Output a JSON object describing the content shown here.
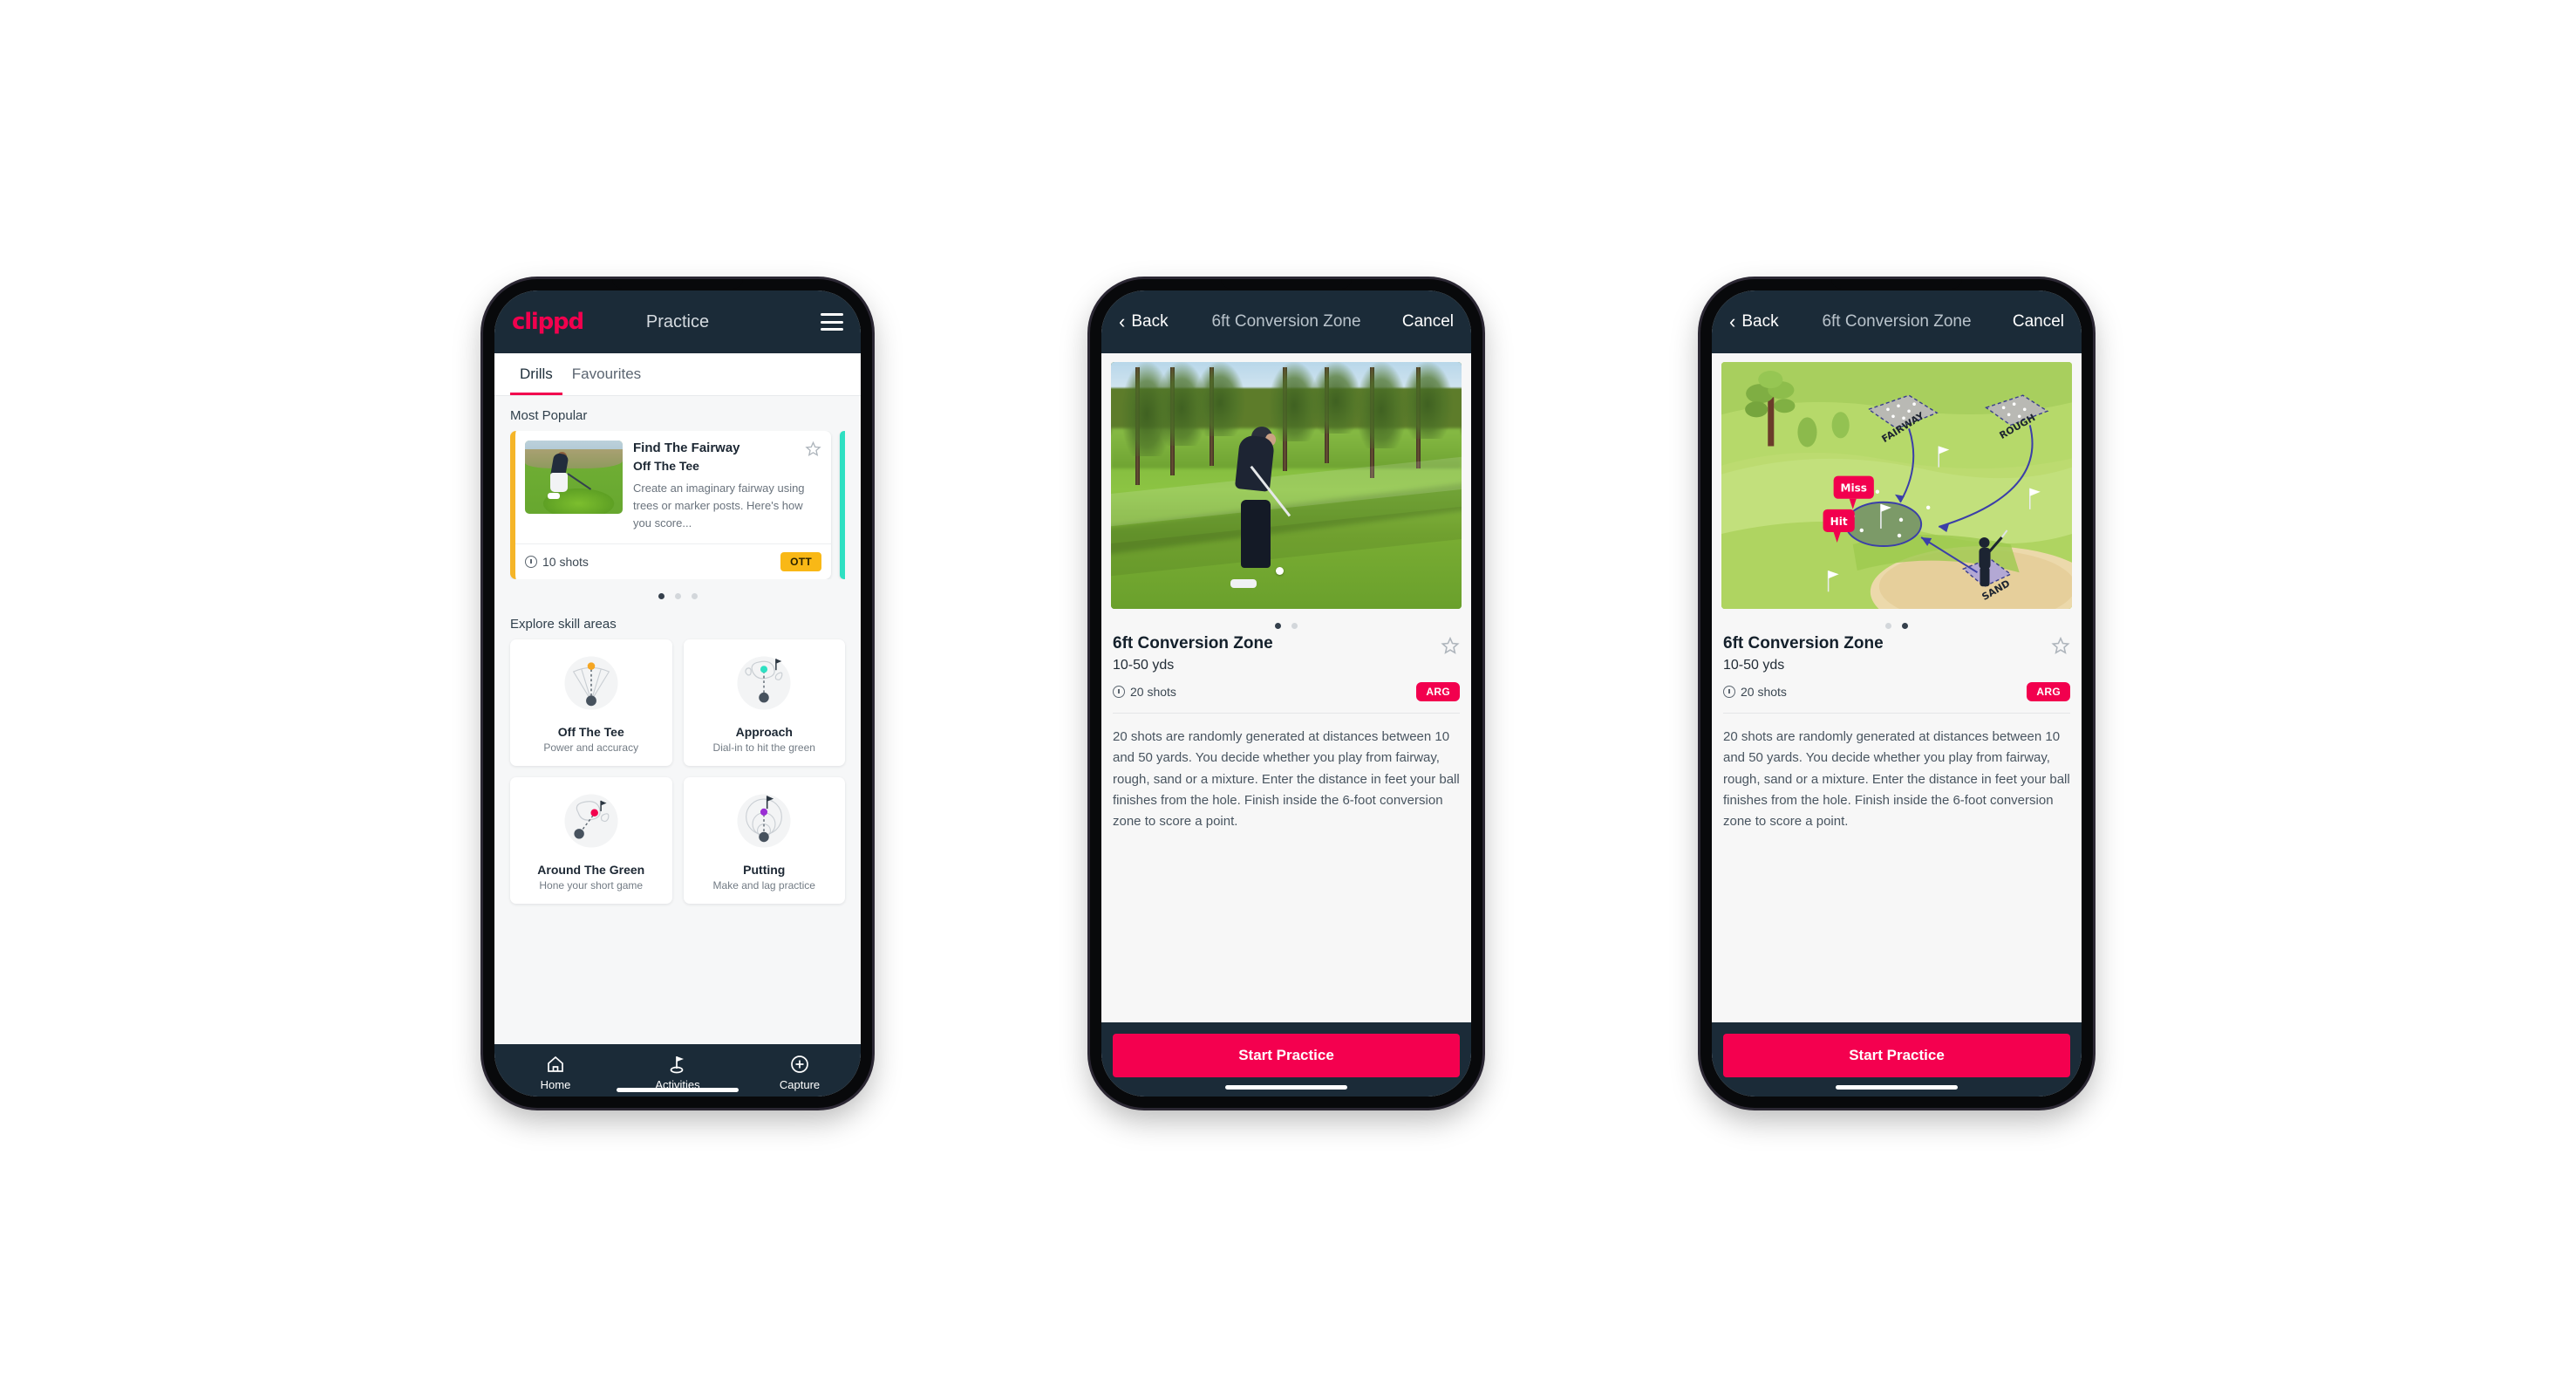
{
  "brand": {
    "name": "clippd",
    "accent": "#f2004e",
    "dark": "#1b2b38",
    "amber": "#f9b816",
    "teal": "#2ee0c2"
  },
  "phone1": {
    "appbar": {
      "logo": "clippd",
      "title": "Practice",
      "menu_icon": "hamburger-icon"
    },
    "tabs": [
      {
        "label": "Drills",
        "active": true
      },
      {
        "label": "Favourites",
        "active": false
      }
    ],
    "sections": {
      "most_popular_label": "Most Popular",
      "explore_label": "Explore skill areas"
    },
    "drill_card": {
      "title": "Find The Fairway",
      "subtitle": "Off The Tee",
      "description": "Create an imaginary fairway using trees or marker posts. Here's how you score...",
      "shots": "10 shots",
      "badge": "OTT",
      "badge_color": "#f9b816",
      "accent_color": "#f5b528",
      "favourite_icon": "star-outline-icon"
    },
    "carousel": {
      "total": 3,
      "active_index": 0
    },
    "skill_areas": [
      {
        "name": "Off The Tee",
        "tag": "Power and accuracy",
        "icon": "tee-fan-icon",
        "dot_color": "#f5a623"
      },
      {
        "name": "Approach",
        "tag": "Dial-in to hit the green",
        "icon": "approach-green-icon",
        "dot_color": "#2ee0c2"
      },
      {
        "name": "Around The Green",
        "tag": "Hone your short game",
        "icon": "around-green-icon",
        "dot_color": "#f2004e"
      },
      {
        "name": "Putting",
        "tag": "Make and lag practice",
        "icon": "putting-rings-icon",
        "dot_color": "#9b2fd4"
      }
    ],
    "tabbar": [
      {
        "label": "Home",
        "icon": "home-icon",
        "active": false
      },
      {
        "label": "Activities",
        "icon": "golf-flag-icon",
        "active": true
      },
      {
        "label": "Capture",
        "icon": "plus-circle-icon",
        "active": false
      }
    ]
  },
  "phone2": {
    "navbar": {
      "back": "Back",
      "title": "6ft Conversion Zone",
      "cancel": "Cancel",
      "back_icon": "chevron-left-icon"
    },
    "media_type": "photo-golfer-chipping",
    "carousel": {
      "total": 2,
      "active_index": 0
    },
    "detail": {
      "title": "6ft Conversion Zone",
      "yards": "10-50 yds",
      "shots": "20 shots",
      "badge": "ARG",
      "badge_color": "#f2004e",
      "favourite_icon": "star-outline-icon",
      "description": "20 shots are randomly generated at distances between 10 and 50 yards. You decide whether you play from fairway, rough, sand or a mixture. Enter the distance in feet your ball finishes from the hole. Finish inside the 6-foot conversion zone to score a point."
    },
    "cta": "Start Practice"
  },
  "phone3": {
    "navbar": {
      "back": "Back",
      "title": "6ft Conversion Zone",
      "cancel": "Cancel",
      "back_icon": "chevron-left-icon"
    },
    "media_type": "course-diagram",
    "diagram": {
      "zone_labels": [
        "FAIRWAY",
        "ROUGH",
        "SAND"
      ],
      "pins": [
        {
          "label": "Miss",
          "color": "#f2004e"
        },
        {
          "label": "Hit",
          "color": "#f2004e"
        }
      ],
      "conversion_zone": "6ft ellipse around hole",
      "arrow_color": "#3b3fa8"
    },
    "carousel": {
      "total": 2,
      "active_index": 1
    },
    "detail": {
      "title": "6ft Conversion Zone",
      "yards": "10-50 yds",
      "shots": "20 shots",
      "badge": "ARG",
      "badge_color": "#f2004e",
      "favourite_icon": "star-outline-icon",
      "description": "20 shots are randomly generated at distances between 10 and 50 yards. You decide whether you play from fairway, rough, sand or a mixture. Enter the distance in feet your ball finishes from the hole. Finish inside the 6-foot conversion zone to score a point."
    },
    "cta": "Start Practice"
  }
}
